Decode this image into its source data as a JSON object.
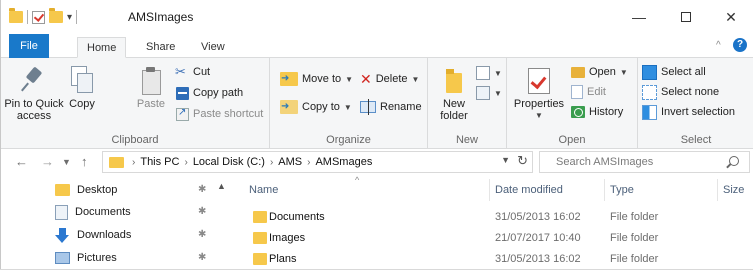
{
  "window": {
    "title": "AMSImages",
    "qat_dropdown": "▾",
    "controls": {
      "minimize": "—",
      "close": "✕"
    }
  },
  "tabs": {
    "file": "File",
    "home": "Home",
    "share": "Share",
    "view": "View",
    "collapse": "^",
    "help": "?"
  },
  "ribbon": {
    "clipboard": {
      "label": "Clipboard",
      "pin": "Pin to Quick\naccess",
      "copy": "Copy",
      "paste": "Paste",
      "cut": "Cut",
      "copy_path": "Copy path",
      "paste_shortcut": "Paste shortcut"
    },
    "organize": {
      "label": "Organize",
      "move_to": "Move to",
      "copy_to": "Copy to",
      "delete": "Delete",
      "rename": "Rename"
    },
    "new": {
      "label": "New",
      "new_folder": "New\nfolder"
    },
    "open": {
      "label": "Open",
      "properties": "Properties",
      "open": "Open",
      "edit": "Edit",
      "history": "History"
    },
    "select": {
      "label": "Select",
      "select_all": "Select all",
      "select_none": "Select none",
      "invert_selection": "Invert selection"
    }
  },
  "address": {
    "breadcrumbs": [
      "This PC",
      "Local Disk (C:)",
      "AMS",
      "AMSmages"
    ],
    "search_placeholder": "Search AMSImages"
  },
  "nav_pane": [
    {
      "label": "Desktop",
      "icon": "folder-icon"
    },
    {
      "label": "Documents",
      "icon": "documents-icon"
    },
    {
      "label": "Downloads",
      "icon": "downloads-icon"
    },
    {
      "label": "Pictures",
      "icon": "pictures-icon"
    }
  ],
  "columns": {
    "name": "Name",
    "date": "Date modified",
    "type": "Type",
    "size": "Size"
  },
  "files": [
    {
      "name": "Documents",
      "date": "31/05/2013 16:02",
      "type": "File folder"
    },
    {
      "name": "Images",
      "date": "21/07/2017 10:40",
      "type": "File folder"
    },
    {
      "name": "Plans",
      "date": "31/05/2013 16:02",
      "type": "File folder"
    }
  ],
  "colors": {
    "accent": "#1979ca",
    "folder": "#f6c84b",
    "delete": "#d1251f"
  }
}
